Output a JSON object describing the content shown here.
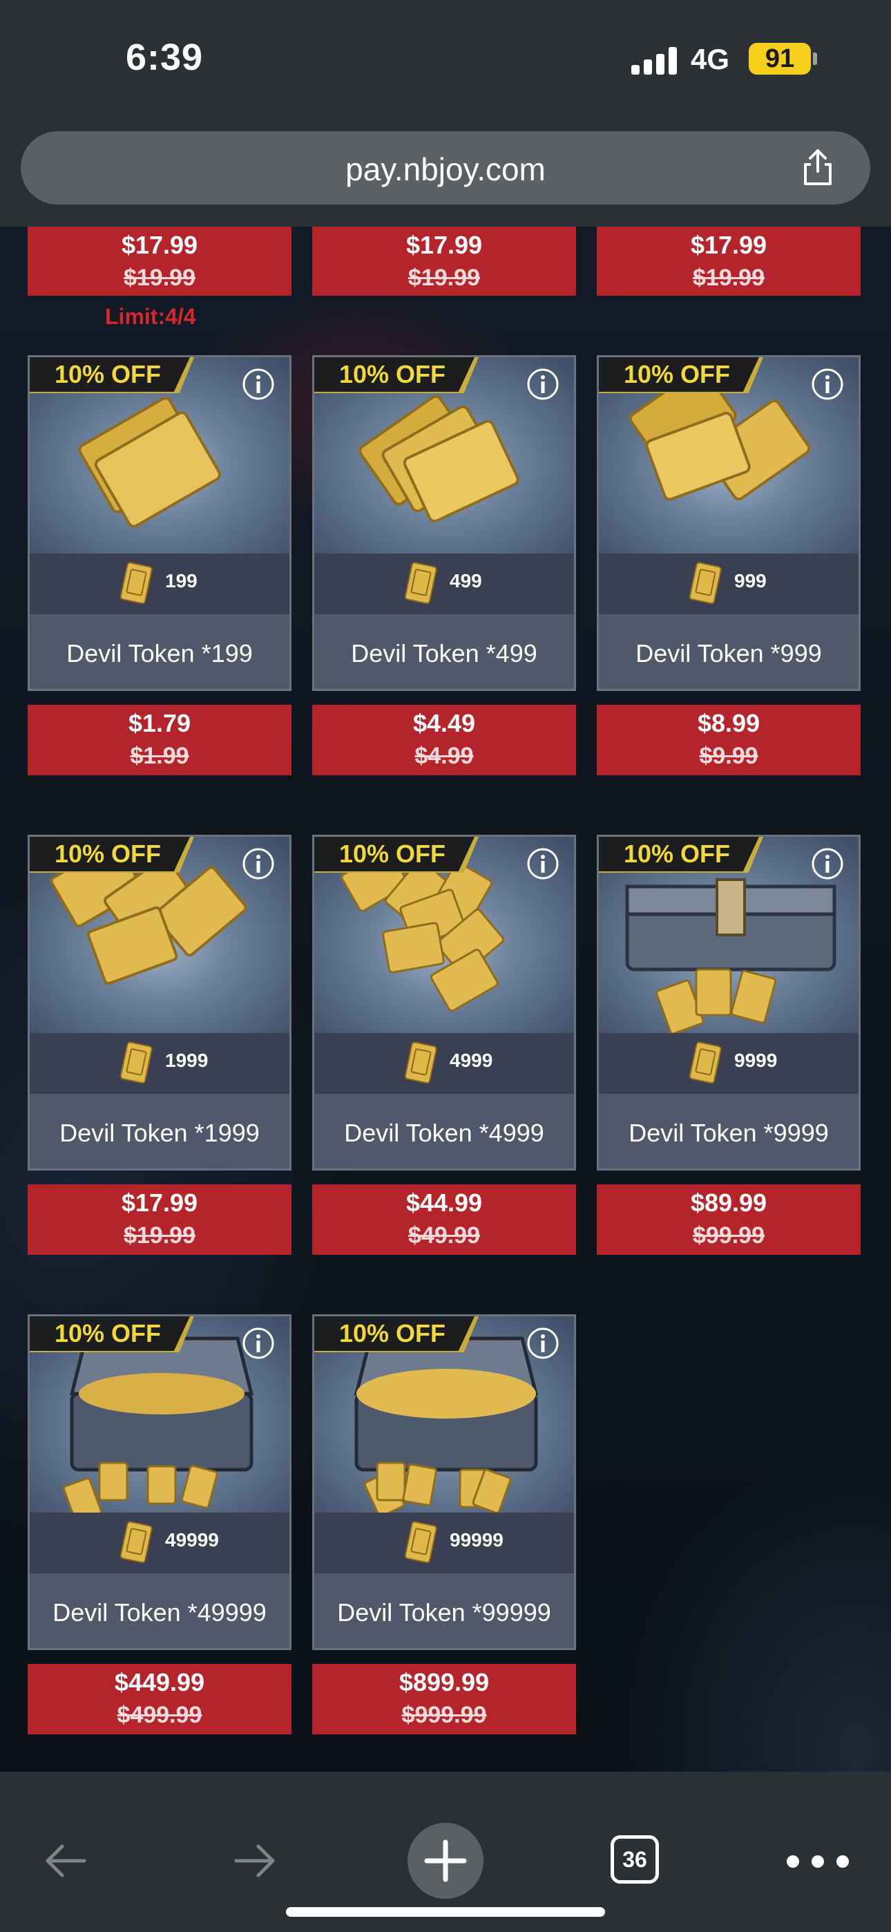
{
  "status_bar": {
    "time": "6:39",
    "network": "4G",
    "battery": "91"
  },
  "browser": {
    "url": "pay.nbjoy.com",
    "tab_count": "36"
  },
  "top_row_prices": [
    {
      "price": "$17.99",
      "original_price": "$19.99"
    },
    {
      "price": "$17.99",
      "original_price": "$19.99"
    },
    {
      "price": "$17.99",
      "original_price": "$19.99"
    }
  ],
  "limit_text": "Limit:4/4",
  "discount_label": "10% OFF",
  "products": [
    {
      "name": "Devil Token *199",
      "quantity": "199",
      "price": "$1.79",
      "original_price": "$1.99",
      "art": "token-cards-small"
    },
    {
      "name": "Devil Token *499",
      "quantity": "499",
      "price": "$4.49",
      "original_price": "$4.99",
      "art": "token-cards-fan"
    },
    {
      "name": "Devil Token *999",
      "quantity": "999",
      "price": "$8.99",
      "original_price": "$9.99",
      "art": "token-cards-spread"
    },
    {
      "name": "Devil Token *1999",
      "quantity": "1999",
      "price": "$17.99",
      "original_price": "$19.99",
      "art": "token-cards-pile"
    },
    {
      "name": "Devil Token *4999",
      "quantity": "4999",
      "price": "$44.99",
      "original_price": "$49.99",
      "art": "token-heap"
    },
    {
      "name": "Devil Token *9999",
      "quantity": "9999",
      "price": "$89.99",
      "original_price": "$99.99",
      "art": "token-chest-closed"
    },
    {
      "name": "Devil Token *49999",
      "quantity": "49999",
      "price": "$449.99",
      "original_price": "$499.99",
      "art": "token-chest-open"
    },
    {
      "name": "Devil Token *99999",
      "quantity": "99999",
      "price": "$899.99",
      "original_price": "$999.99",
      "art": "token-chest-overflow"
    }
  ],
  "colors": {
    "price_red": "#b5232b",
    "badge_gold": "#f2d83a",
    "limit_red": "#d7262e"
  }
}
